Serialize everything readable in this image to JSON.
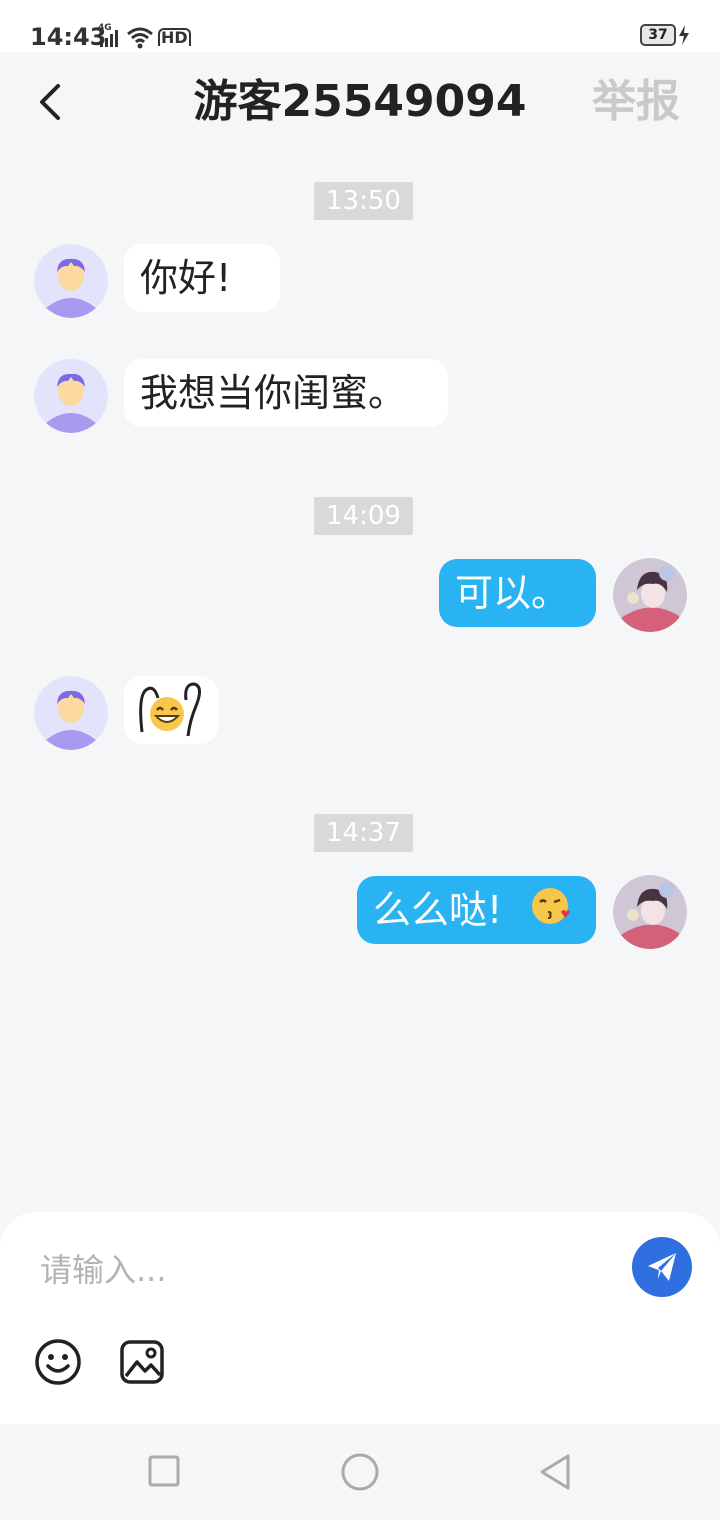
{
  "status_bar": {
    "time": "14:43",
    "network": "4G",
    "hd": "HD",
    "battery": "37"
  },
  "header": {
    "title": "游客25549094",
    "report_label": "举报"
  },
  "messages": [
    {
      "type": "time",
      "text": "13:50"
    },
    {
      "type": "incoming",
      "text": "你好!"
    },
    {
      "type": "incoming",
      "text": "我想当你闺蜜。"
    },
    {
      "type": "time",
      "text": "14:09"
    },
    {
      "type": "outgoing",
      "text": "可以。"
    },
    {
      "type": "incoming",
      "text": "",
      "emoji": "grinning-sticker"
    },
    {
      "type": "time",
      "text": "14:37"
    },
    {
      "type": "outgoing",
      "text": "么么哒!",
      "emoji": "kissing-face"
    }
  ],
  "input": {
    "placeholder": "请输入...",
    "value": ""
  },
  "toolbar": {
    "emoji_icon": "smiley-icon",
    "image_icon": "image-icon",
    "send_icon": "send-icon"
  },
  "colors": {
    "background": "#f4f6f7",
    "outgoing_bubble": "#2ab3f2",
    "incoming_bubble": "#ffffff",
    "send_button": "#2f6fe0",
    "time_chip": "#d9d9d9",
    "report_text": "#c9c9c9"
  }
}
